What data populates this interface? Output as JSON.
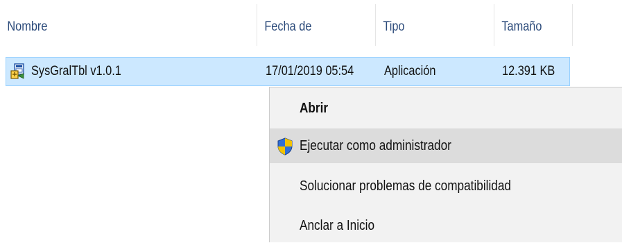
{
  "header": {
    "col_name": "Nombre",
    "col_date": "Fecha de modifica...",
    "col_type": "Tipo",
    "col_size": "Tamaño"
  },
  "file": {
    "name": "SysGralTbl v1.0.1",
    "date": "17/01/2019 05:54",
    "type": "Aplicación",
    "size": "12.391 KB",
    "icon": "application-setup-icon"
  },
  "context_menu": {
    "items": [
      {
        "label": "Abrir",
        "bold": true
      },
      {
        "label": "Ejecutar como administrador",
        "icon": "uac-shield-icon",
        "highlighted": true
      },
      {
        "label": "Solucionar problemas de compatibilidad"
      },
      {
        "label": "Anclar a Inicio"
      }
    ]
  },
  "colors": {
    "selection_bg": "#cce8ff",
    "selection_border": "#99d1ff",
    "menu_bg": "#f2f2f2",
    "menu_hover": "#dcdcdc",
    "header_text": "#2b4a7a"
  }
}
